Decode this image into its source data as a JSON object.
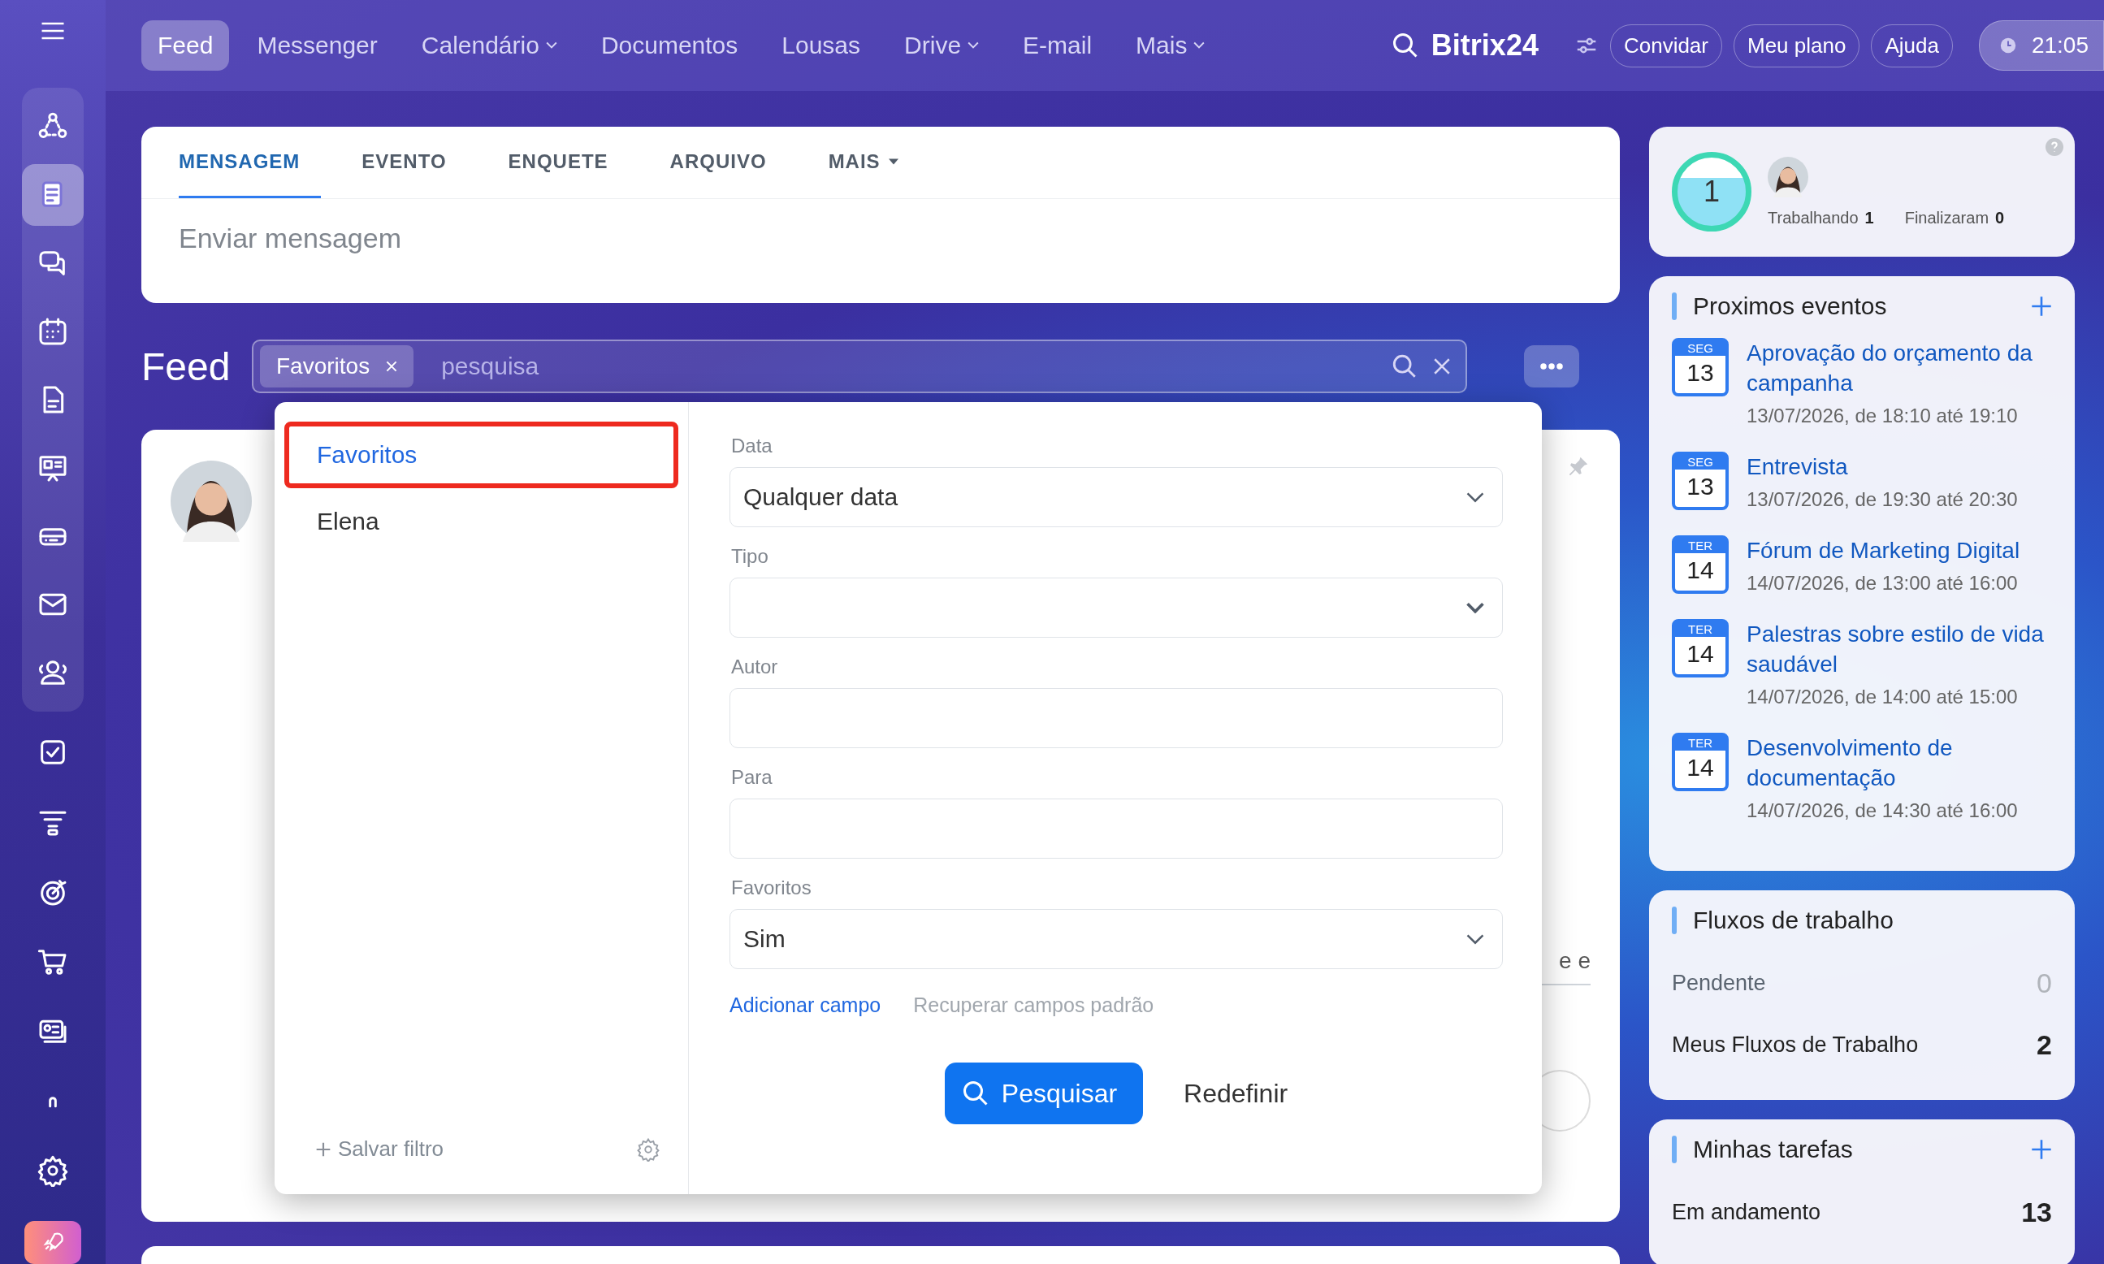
{
  "top_nav": {
    "items": [
      {
        "label": "Feed",
        "selected": true,
        "dropdown": false
      },
      {
        "label": "Messenger",
        "selected": false,
        "dropdown": false
      },
      {
        "label": "Calendário",
        "selected": false,
        "dropdown": true
      },
      {
        "label": "Documentos",
        "selected": false,
        "dropdown": false
      },
      {
        "label": "Lousas",
        "selected": false,
        "dropdown": false
      },
      {
        "label": "Drive",
        "selected": false,
        "dropdown": true
      },
      {
        "label": "E-mail",
        "selected": false,
        "dropdown": false
      },
      {
        "label": "Mais",
        "selected": false,
        "dropdown": true
      }
    ],
    "brand": "Bitrix24",
    "buttons": [
      "Convidar",
      "Meu plano",
      "Ajuda"
    ],
    "clock": "21:05"
  },
  "sidebar": {
    "items": [
      {
        "kind": "nodes",
        "selected": false
      },
      {
        "kind": "news",
        "selected": true
      },
      {
        "kind": "chat",
        "selected": false
      },
      {
        "kind": "calendar",
        "selected": false
      },
      {
        "kind": "document",
        "selected": false
      },
      {
        "kind": "board",
        "selected": false
      },
      {
        "kind": "drive",
        "selected": false
      },
      {
        "kind": "mail",
        "selected": false
      },
      {
        "kind": "people",
        "selected": false
      },
      {
        "kind": "task",
        "selected": false
      },
      {
        "kind": "funnel",
        "selected": false
      },
      {
        "kind": "target",
        "selected": false
      },
      {
        "kind": "cart",
        "selected": false
      },
      {
        "kind": "contact",
        "selected": false
      },
      {
        "kind": "arch",
        "selected": false
      },
      {
        "kind": "gear",
        "selected": false
      }
    ]
  },
  "composer": {
    "tabs": [
      {
        "label": "MENSAGEM",
        "selected": true,
        "dropdown": false
      },
      {
        "label": "EVENTO",
        "selected": false,
        "dropdown": false
      },
      {
        "label": "ENQUETE",
        "selected": false,
        "dropdown": false
      },
      {
        "label": "ARQUIVO",
        "selected": false,
        "dropdown": false
      },
      {
        "label": "MAIS",
        "selected": false,
        "dropdown": true
      }
    ],
    "placeholder": "Enviar mensagem"
  },
  "feed": {
    "title": "Feed",
    "filter_tag": "Favoritos",
    "search_placeholder": "pesquisa"
  },
  "post": {
    "text_fragment": "e e"
  },
  "filter_popup": {
    "presets": [
      {
        "label": "Favoritos",
        "selected": true
      },
      {
        "label": "Elena",
        "selected": false
      }
    ],
    "save_filter": "Salvar filtro",
    "fields": [
      {
        "label": "Data",
        "kind": "select",
        "value": "Qualquer data"
      },
      {
        "label": "Tipo",
        "kind": "select"
      },
      {
        "label": "Autor",
        "kind": "text"
      },
      {
        "label": "Para",
        "kind": "text"
      },
      {
        "label": "Favoritos",
        "kind": "select",
        "value": "Sim"
      }
    ],
    "add_field": "Adicionar campo",
    "restore_fields": "Recuperar campos padrão",
    "search_button": "Pesquisar",
    "reset_button": "Redefinir"
  },
  "timeman": {
    "count": "1",
    "working_label": "Trabalhando",
    "working": "1",
    "finished_label": "Finalizaram",
    "finished": "0"
  },
  "events": {
    "title": "Proximos eventos",
    "items": [
      {
        "weekday": "SEG",
        "day": "13",
        "title": "Aprovação do orçamento da campanha",
        "time": "13/07/2026, de 18:10 até 19:10"
      },
      {
        "weekday": "SEG",
        "day": "13",
        "title": "Entrevista",
        "time": "13/07/2026, de 19:30 até 20:30"
      },
      {
        "weekday": "TER",
        "day": "14",
        "title": "Fórum de Marketing Digital",
        "time": "14/07/2026, de 13:00 até 16:00"
      },
      {
        "weekday": "TER",
        "day": "14",
        "title": "Palestras sobre estilo de vida saudável",
        "time": "14/07/2026, de 14:00 até 15:00"
      },
      {
        "weekday": "TER",
        "day": "14",
        "title": "Desenvolvimento de documentação",
        "time": "14/07/2026, de 14:30 até 16:00"
      }
    ]
  },
  "workflows": {
    "title": "Fluxos de trabalho",
    "rows": [
      {
        "label": "Pendente",
        "value": "0",
        "disabled": true
      },
      {
        "label": "Meus Fluxos de Trabalho",
        "value": "2",
        "disabled": false
      }
    ]
  },
  "tasks": {
    "title": "Minhas tarefas",
    "rows": [
      {
        "label": "Em andamento",
        "value": "13",
        "disabled": false
      }
    ]
  }
}
